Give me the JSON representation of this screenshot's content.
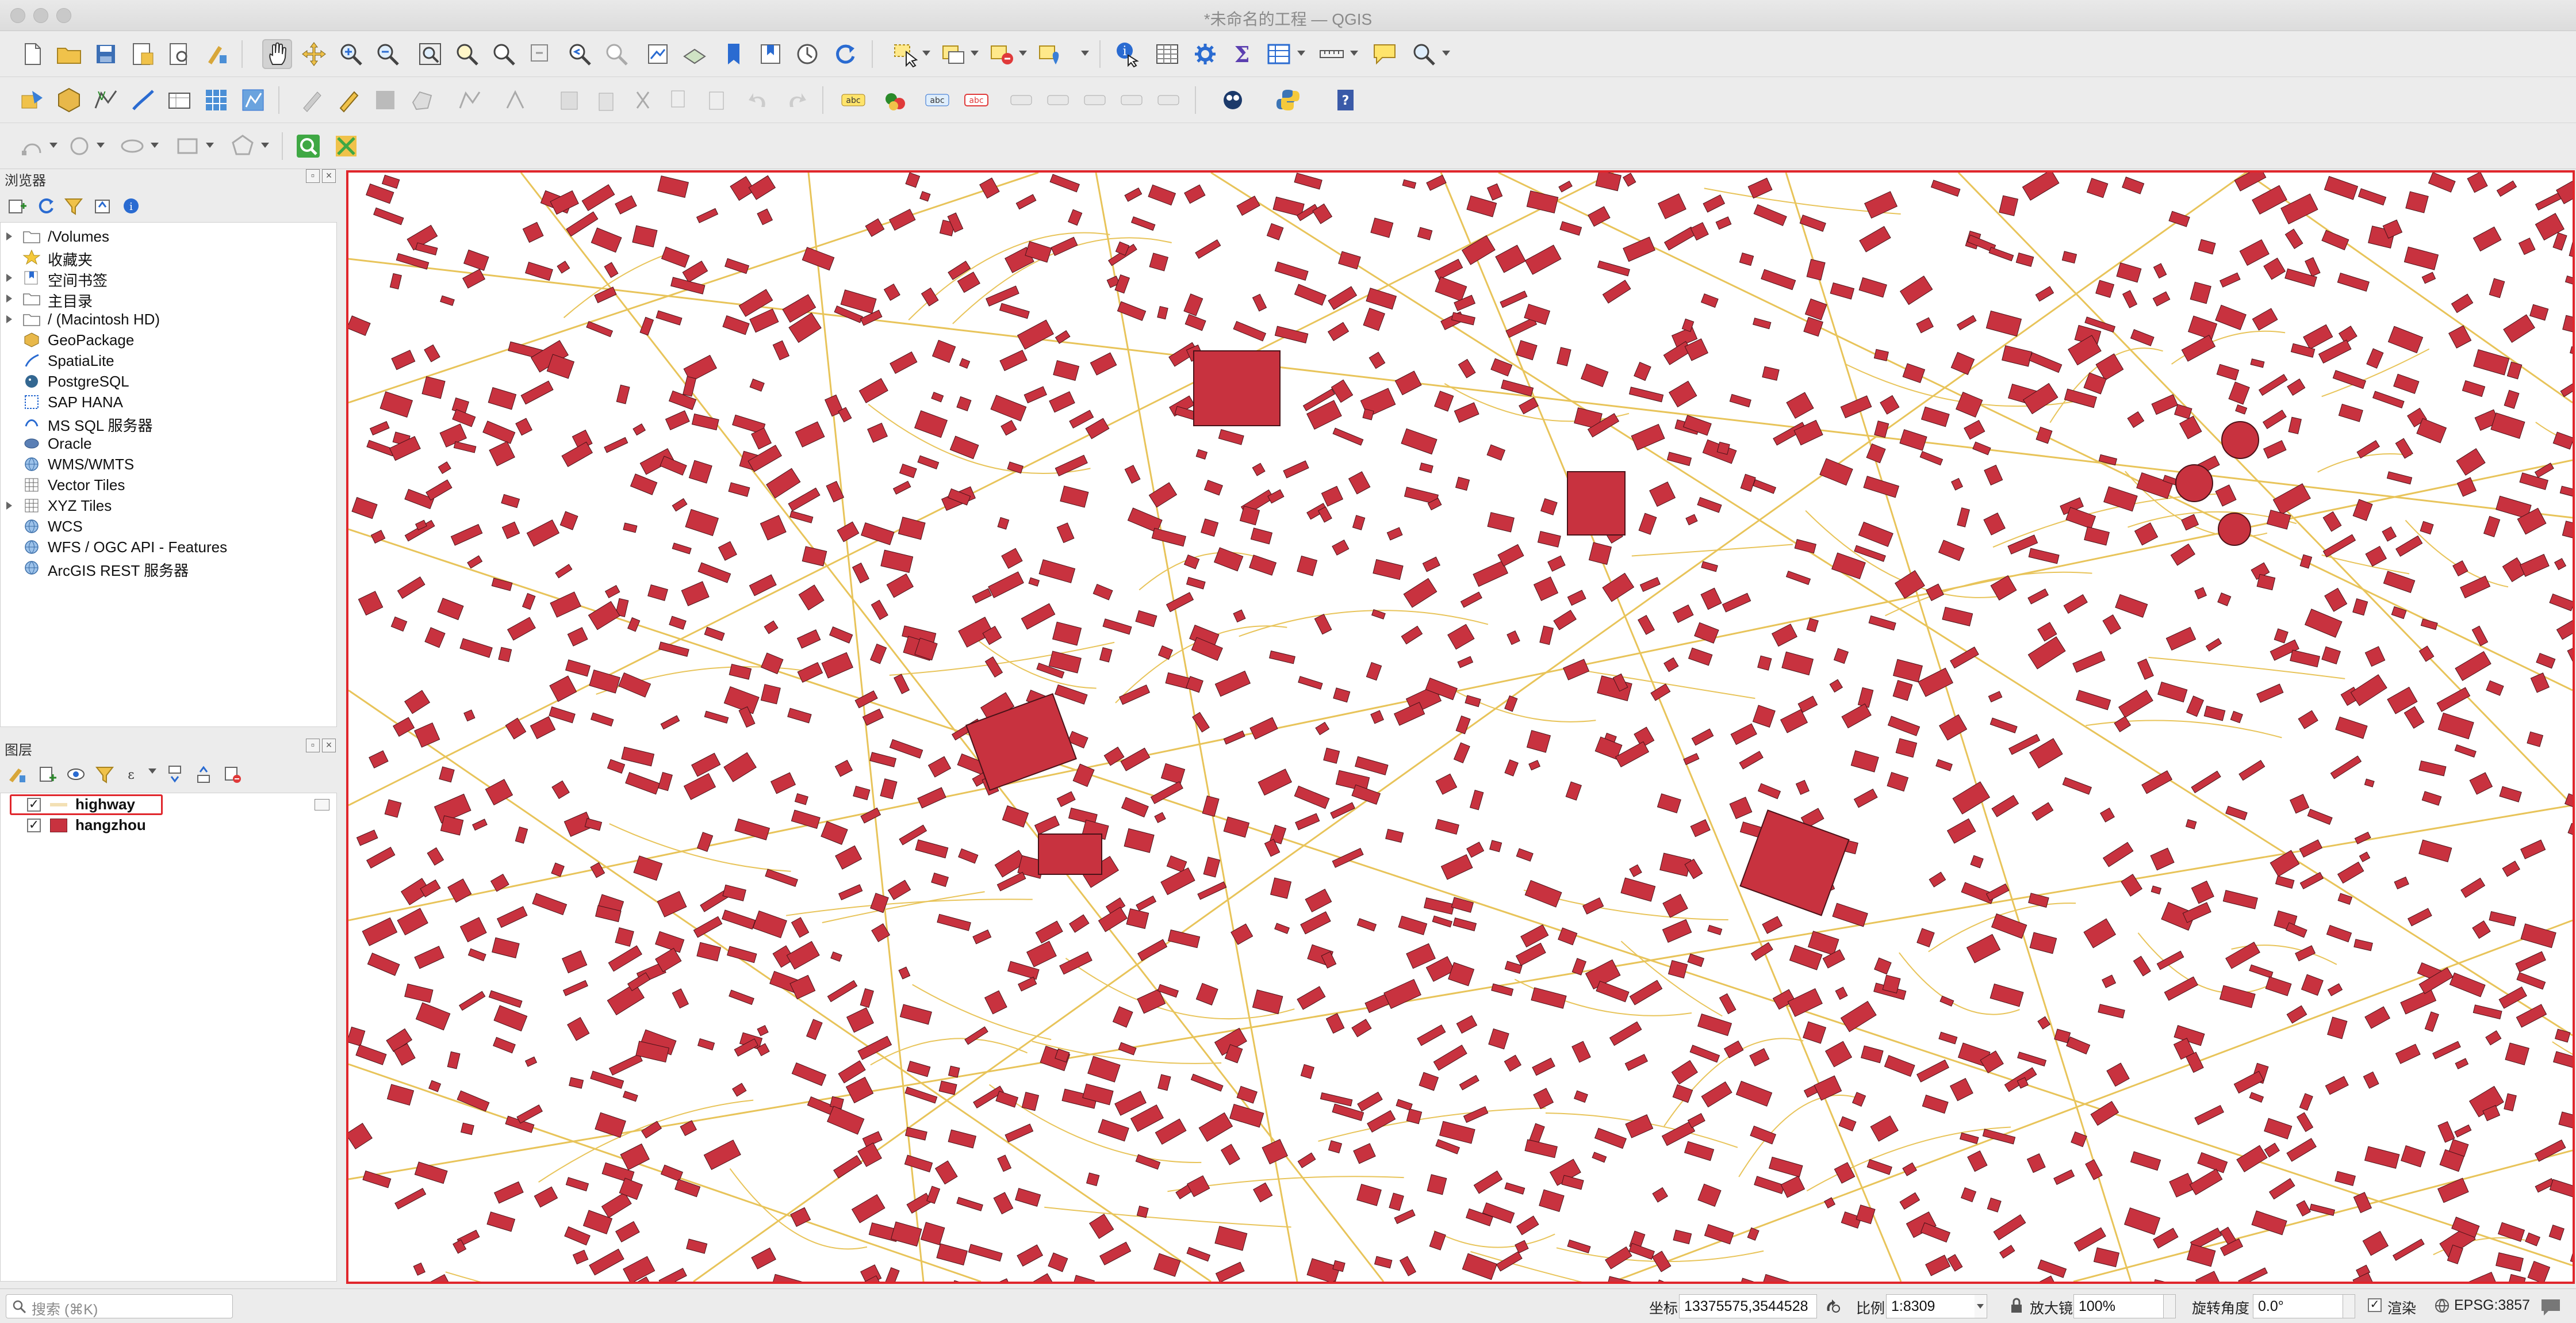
{
  "window": {
    "title": "*未命名的工程 — QGIS"
  },
  "browser_panel": {
    "title": "浏览器",
    "items": [
      {
        "label": "/Volumes",
        "icon": "folder-icon",
        "expandable": true
      },
      {
        "label": "收藏夹",
        "icon": "star-icon",
        "expandable": false
      },
      {
        "label": "空间书签",
        "icon": "bookmark-icon",
        "expandable": true
      },
      {
        "label": "主目录",
        "icon": "folder-icon",
        "expandable": true
      },
      {
        "label": "/ (Macintosh HD)",
        "icon": "folder-icon",
        "expandable": true
      },
      {
        "label": "GeoPackage",
        "icon": "geopackage-icon",
        "expandable": false
      },
      {
        "label": "SpatiaLite",
        "icon": "spatialite-icon",
        "expandable": false
      },
      {
        "label": "PostgreSQL",
        "icon": "postgresql-icon",
        "expandable": false
      },
      {
        "label": "SAP HANA",
        "icon": "sap-hana-icon",
        "expandable": false
      },
      {
        "label": "MS SQL 服务器",
        "icon": "mssql-icon",
        "expandable": false
      },
      {
        "label": "Oracle",
        "icon": "oracle-icon",
        "expandable": false
      },
      {
        "label": "WMS/WMTS",
        "icon": "globe-icon",
        "expandable": false
      },
      {
        "label": "Vector Tiles",
        "icon": "grid-icon",
        "expandable": false
      },
      {
        "label": "XYZ Tiles",
        "icon": "grid-icon",
        "expandable": true
      },
      {
        "label": "WCS",
        "icon": "globe-icon",
        "expandable": false
      },
      {
        "label": "WFS / OGC API - Features",
        "icon": "globe-icon",
        "expandable": false
      },
      {
        "label": "ArcGIS REST 服务器",
        "icon": "globe-icon",
        "expandable": false
      }
    ]
  },
  "layers_panel": {
    "title": "图层",
    "layers": [
      {
        "label": "highway",
        "checked": true,
        "symbol_color": "#f3e0b5",
        "selected": true
      },
      {
        "label": "hangzhou",
        "checked": true,
        "symbol_color": "#c8323f",
        "selected": false
      }
    ]
  },
  "map": {
    "building_color": "#c8323f",
    "road_color": "#e8c45a",
    "frame_color": "#e0262c"
  },
  "statusbar": {
    "search_placeholder": "搜索 (⌘K)",
    "coordinate_label": "坐标",
    "coordinate_value": "13375575,3544528",
    "scale_label": "比例",
    "scale_value": "1:8309",
    "magnifier_label": "放大镜",
    "magnifier_value": "100%",
    "rotation_label": "旋转角度",
    "rotation_value": "0.0°",
    "render_label": "渲染",
    "render_checked": true,
    "crs_label": "EPSG:3857"
  }
}
